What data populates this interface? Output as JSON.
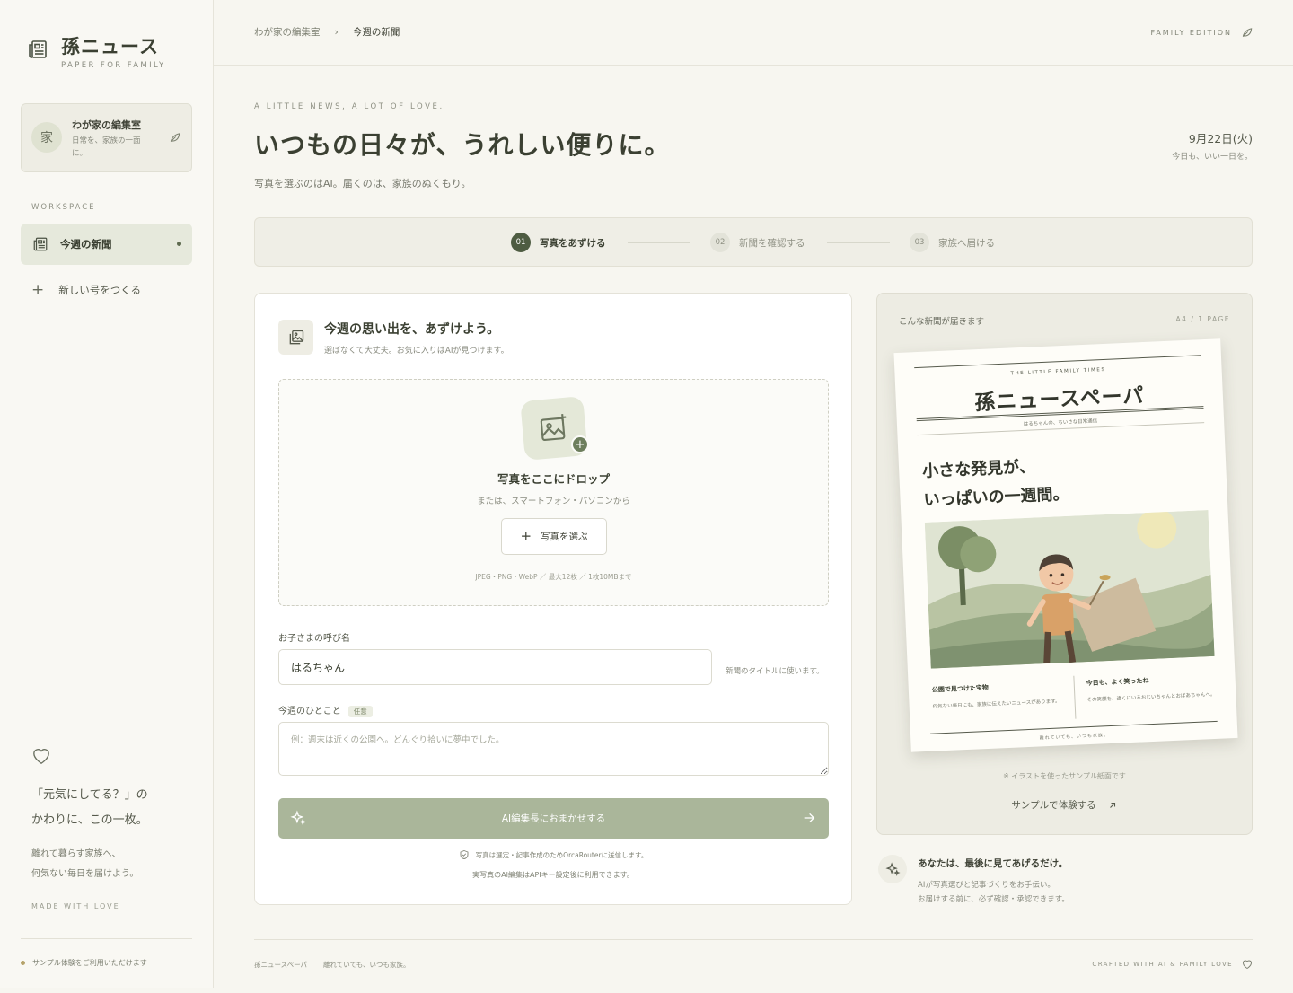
{
  "brand": {
    "title": "孫ニュース",
    "subtitle": "PAPER FOR FAMILY"
  },
  "room": {
    "avatar": "家",
    "name": "わが家の編集室",
    "description": "日常を、家族の一面に。"
  },
  "sidebar": {
    "section_label": "WORKSPACE",
    "active_item": "今週の新聞",
    "new_item": "新しい号をつくる",
    "quote_line1": "「元気にしてる？」の",
    "quote_line2": "かわりに、この一枚。",
    "text_line1": "離れて暮らす家族へ、",
    "text_line2": "何気ない毎日を届けよう。",
    "made": "MADE WITH LOVE",
    "sample_note": "サンプル体験をご利用いただけます"
  },
  "breadcrumb": {
    "root": "わが家の編集室",
    "current": "今週の新聞"
  },
  "edition": "FAMILY EDITION",
  "hero": {
    "eyebrow": "A LITTLE NEWS, A LOT OF LOVE.",
    "title": "いつもの日々が、うれしい便りに。",
    "subtitle": "写真を選ぶのはAI。届くのは、家族のぬくもり。",
    "date": "9月22日(火)",
    "date_sub": "今日も、いい一日を。"
  },
  "steps": [
    {
      "num": "01",
      "label": "写真をあずける",
      "state": "active"
    },
    {
      "num": "02",
      "label": "新聞を確認する",
      "state": "idle"
    },
    {
      "num": "03",
      "label": "家族へ届ける",
      "state": "idle"
    }
  ],
  "upload": {
    "title": "今週の思い出を、あずけよう。",
    "subtitle": "選ばなくて大丈夫。お気に入りはAIが見つけます。",
    "drop_title": "写真をここにドロップ",
    "drop_sub": "または、スマートフォン・パソコンから",
    "choose_button": "写真を選ぶ",
    "formats": "JPEG・PNG・WebP ／ 最大12枚 ／ 1枚10MBまで",
    "name_label": "お子さまの呼び名",
    "name_value": "はるちゃん",
    "name_hint": "新聞のタイトルに使います。",
    "memo_label": "今週のひとこと",
    "memo_tag": "任意",
    "memo_placeholder": "例：週末は近くの公園へ。どんぐり拾いに夢中でした。",
    "cta": "AI編集長におまかせする",
    "privacy": "写真は選定・記事作成のためOrcaRouterに送信します。",
    "privacy2": "実写真のAI編集はAPIキー設定後に利用できます。"
  },
  "preview": {
    "label": "こんな新聞が届きます",
    "page": "A4 / 1 PAGE",
    "paper": {
      "kicker": "THE LITTLE FAMILY TIMES",
      "title": "孫ニュースペーパ",
      "byline": "はるちゃんの、ちいさな日常通信",
      "headline1": "小さな発見が、",
      "headline2": "いっぱいの一週間。",
      "col1_title": "公園で見つけた宝物",
      "col1_body": "何気ない毎日にも、家族に伝えたいニュースがあります。",
      "col2_title": "今日も、よく笑ったね",
      "col2_body": "その笑顔を、遠くにいるおじいちゃんとおばあちゃんへ。",
      "footer": "離れていても、いつも家族。"
    },
    "caption": "※ イラストを使ったサンプル紙面です",
    "link": "サンプルで体験する"
  },
  "note": {
    "title": "あなたは、最後に見てあげるだけ。",
    "line1": "AIが写真選びと記事づくりをお手伝い。",
    "line2": "お届けする前に、必ず確認・承認できます。"
  },
  "footer": {
    "left1": "孫ニュースペーパ",
    "left2": "離れていても、いつも家族。",
    "right": "CRAFTED WITH AI & FAMILY LOVE"
  },
  "colors": {
    "accent": "#4e5c42",
    "cta": "#aab69a",
    "background": "#f7f6f0"
  }
}
